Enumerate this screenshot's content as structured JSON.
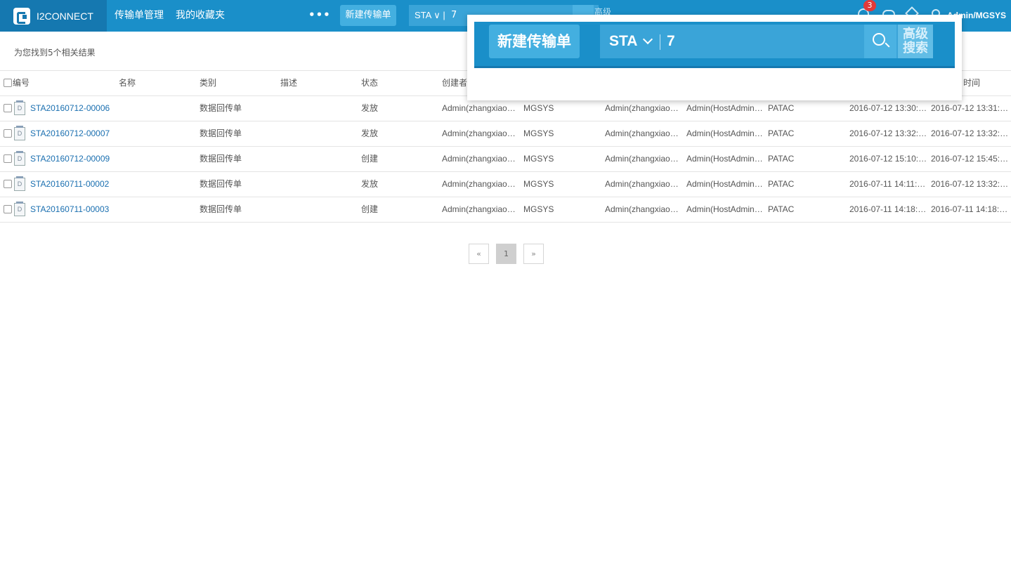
{
  "header": {
    "brand": "I2CONNECT",
    "nav": [
      "传输单管理",
      "我的收藏夹"
    ],
    "more": "•••",
    "new_button": "新建传输单",
    "search_prefix": "STA ∨ |",
    "search_value": "7",
    "advanced": "高级",
    "notification_count": "3",
    "user": "Admin/MGSYS"
  },
  "result_info": "为您找到5个相关结果",
  "table": {
    "columns": [
      "编号",
      "名称",
      "类别",
      "描述",
      "状态",
      "创建者",
      "",
      "",
      "",
      "",
      "",
      "时间"
    ],
    "rows": [
      {
        "id": "STA20160712-00006",
        "name": "",
        "category": "数据回传单",
        "desc": "",
        "status": "发放",
        "creator": "Admin(zhangxiao…",
        "org": "MGSYS",
        "c8": "Admin(zhangxiao…",
        "c9": "Admin(HostAdmin…",
        "c10": "PATAC",
        "c11": "2016-07-12 13:30:…",
        "c12": "2016-07-12 13:31:…"
      },
      {
        "id": "STA20160712-00007",
        "name": "",
        "category": "数据回传单",
        "desc": "",
        "status": "发放",
        "creator": "Admin(zhangxiao…",
        "org": "MGSYS",
        "c8": "Admin(zhangxiao…",
        "c9": "Admin(HostAdmin…",
        "c10": "PATAC",
        "c11": "2016-07-12 13:32:…",
        "c12": "2016-07-12 13:32:…"
      },
      {
        "id": "STA20160712-00009",
        "name": "",
        "category": "数据回传单",
        "desc": "",
        "status": "创建",
        "creator": "Admin(zhangxiao…",
        "org": "MGSYS",
        "c8": "Admin(zhangxiao…",
        "c9": "Admin(HostAdmin…",
        "c10": "PATAC",
        "c11": "2016-07-12 15:10:…",
        "c12": "2016-07-12 15:45:…"
      },
      {
        "id": "STA20160711-00002",
        "name": "",
        "category": "数据回传单",
        "desc": "",
        "status": "发放",
        "creator": "Admin(zhangxiao…",
        "org": "MGSYS",
        "c8": "Admin(zhangxiao…",
        "c9": "Admin(HostAdmin…",
        "c10": "PATAC",
        "c11": "2016-07-11 14:11:…",
        "c12": "2016-07-12 13:32:…"
      },
      {
        "id": "STA20160711-00003",
        "name": "",
        "category": "数据回传单",
        "desc": "",
        "status": "创建",
        "creator": "Admin(zhangxiao…",
        "org": "MGSYS",
        "c8": "Admin(zhangxiao…",
        "c9": "Admin(HostAdmin…",
        "c10": "PATAC",
        "c11": "2016-07-11 14:18:…",
        "c12": "2016-07-11 14:18:…"
      }
    ]
  },
  "doc_icon_letter": "D",
  "pager": {
    "prev": "«",
    "page": "1",
    "next": "»"
  },
  "zoom": {
    "new_button": "新建传输单",
    "search_prefix": "STA",
    "search_value": "7",
    "advanced_1": "高级",
    "advanced_2": "搜索"
  }
}
